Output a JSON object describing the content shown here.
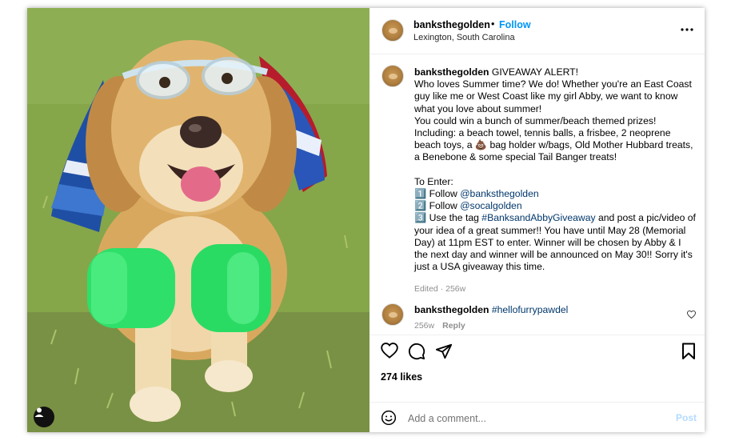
{
  "post": {
    "username": "banksthegolden",
    "follow_label": "Follow",
    "dot": "•",
    "location": "Lexington, South Carolina",
    "more_label": "..."
  },
  "caption": {
    "username": "banksthegolden",
    "lines": {
      "l1": "GIVEAWAY ALERT!",
      "l2": "Who loves Summer time? We do! Whether you're an East Coast guy like me or West Coast like my girl Abby, we want to know what you love about summer!",
      "l3": "You could win a bunch of summer/beach themed prizes! Including: a beach towel, tennis balls, a frisbee, 2 neoprene beach toys, a 💩 bag holder w/bags, Old Mother Hubbard treats, a Benebone & some special Tail Banger treats!",
      "l4": "To Enter:",
      "s1_num": "1️⃣",
      "s1_text": "Follow ",
      "s1_link": "@banksthegolden",
      "s2_num": "2️⃣",
      "s2_text": "Follow ",
      "s2_link": "@socalgolden",
      "s3_num": "3️⃣",
      "s3_text": "Use the tag ",
      "s3_link": "#BanksandAbbyGiveaway",
      "s3_rest": " and post a pic/video of your idea of a great summer!! You have until May 28 (Memorial Day) at 11pm EST to enter. Winner will be chosen by Abby & I the next day and winner will be announced on May 30!! Sorry it's just a USA giveaway this time."
    },
    "meta": "Edited · 256w"
  },
  "comment": {
    "username": "banksthegolden",
    "text": "#hellofurrypawdel",
    "time": "256w",
    "reply_label": "Reply"
  },
  "stats": {
    "likes": "274 likes"
  },
  "add_comment": {
    "placeholder": "Add a comment...",
    "post_label": "Post"
  },
  "colors": {
    "link": "#0095f6",
    "hashtag": "#00376b",
    "muted": "#8e8e8e",
    "post_disabled": "#b3dbff"
  }
}
